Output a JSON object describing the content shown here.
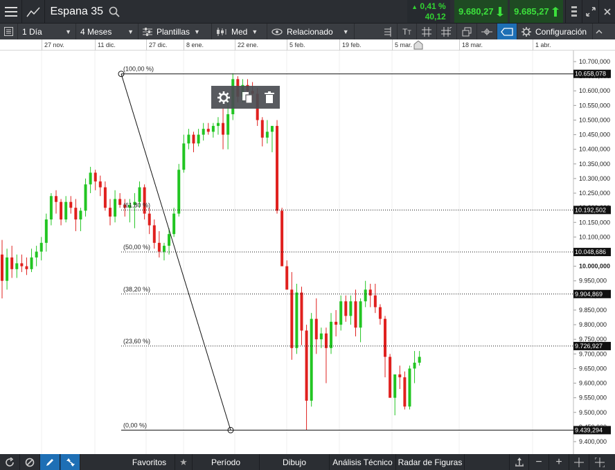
{
  "topbar": {
    "instrument": "Espana 35",
    "change_pct": "0,41 %",
    "change_abs": "40,12",
    "sell_price": "9.680,27",
    "buy_price": "9.685,27"
  },
  "toolbar": {
    "interval": "1 Día",
    "range": "4 Meses",
    "templates": "Plantillas",
    "price_type": "Med",
    "related": "Relacionado",
    "settings": "Configuración"
  },
  "date_axis": [
    "27 nov.",
    "11 dic.",
    "27 dic.",
    "8 ene.",
    "22 ene.",
    "5 feb.",
    "19 feb.",
    "5 mar.",
    "18 mar.",
    "1 abr."
  ],
  "bottombar": {
    "favorites": "Favoritos",
    "period": "Período",
    "drawing": "Dibujo",
    "technical": "Análisis Técnico",
    "patterns": "Radar de Figuras"
  },
  "colors": {
    "up": "#22c522",
    "down": "#e0201e",
    "accent": "#1e6fb5",
    "topbar": "#2b2e33",
    "toolbar": "#3a3d42"
  },
  "chart_data": {
    "type": "candlestick",
    "ylim": [
      9400,
      10700
    ],
    "y_ticks": [
      "10.700,000",
      "10.650,000",
      "10.600,000",
      "10.550,000",
      "10.500,000",
      "10.450,000",
      "10.400,000",
      "10.350,000",
      "10.300,000",
      "10.250,000",
      "10.200,000",
      "10.150,000",
      "10.100,000",
      "10.050,000",
      "10.000,000",
      "9.950,000",
      "9.900,000",
      "9.850,000",
      "9.800,000",
      "9.750,000",
      "9.700,000",
      "9.650,000",
      "9.600,000",
      "9.550,000",
      "9.500,000",
      "9.450,000",
      "9.400,000"
    ],
    "fibonacci": [
      {
        "label": "(100,00 %)",
        "value": 10658.078,
        "price_label": "10.658,078"
      },
      {
        "label": "(61,80 %)",
        "value": 10192.502,
        "price_label": "10.192,502"
      },
      {
        "label": "(50,00 %)",
        "value": 10048.686,
        "price_label": "10.048,686"
      },
      {
        "label": "(38,20 %)",
        "value": 9904.869,
        "price_label": "9.904,869"
      },
      {
        "label": "(23,60 %)",
        "value": 9726.927,
        "price_label": "9.726,927"
      },
      {
        "label": "(0,00 %)",
        "value": 9439.294,
        "price_label": "9.439,294"
      }
    ],
    "candles": [
      [
        10040,
        10090,
        9890,
        9950
      ],
      [
        9950,
        10060,
        9920,
        10030
      ],
      [
        10030,
        10070,
        9960,
        9990
      ],
      [
        9990,
        10040,
        9960,
        10010
      ],
      [
        10010,
        10040,
        9980,
        10000
      ],
      [
        10000,
        10030,
        9970,
        9990
      ],
      [
        9990,
        10060,
        9980,
        10030
      ],
      [
        10030,
        10070,
        10000,
        10050
      ],
      [
        10050,
        10100,
        10020,
        10080
      ],
      [
        10080,
        10180,
        10050,
        10160
      ],
      [
        10160,
        10250,
        10140,
        10240
      ],
      [
        10240,
        10260,
        10180,
        10220
      ],
      [
        10220,
        10230,
        10140,
        10160
      ],
      [
        10160,
        10240,
        10150,
        10220
      ],
      [
        10220,
        10240,
        10180,
        10200
      ],
      [
        10200,
        10230,
        10120,
        10160
      ],
      [
        10160,
        10200,
        10120,
        10190
      ],
      [
        10190,
        10300,
        10170,
        10280
      ],
      [
        10280,
        10340,
        10250,
        10320
      ],
      [
        10320,
        10330,
        10260,
        10290
      ],
      [
        10290,
        10310,
        10240,
        10270
      ],
      [
        10270,
        10290,
        10190,
        10200
      ],
      [
        10200,
        10230,
        10140,
        10170
      ],
      [
        10170,
        10260,
        10150,
        10230
      ],
      [
        10230,
        10250,
        10200,
        10210
      ],
      [
        10210,
        10230,
        10170,
        10200
      ],
      [
        10200,
        10230,
        10150,
        10210
      ],
      [
        10210,
        10250,
        10130,
        10220
      ],
      [
        10220,
        10290,
        10200,
        10270
      ],
      [
        10270,
        10280,
        10160,
        10180
      ],
      [
        10180,
        10200,
        10110,
        10140
      ],
      [
        10140,
        10160,
        10060,
        10080
      ],
      [
        10080,
        10120,
        10030,
        10050
      ],
      [
        10050,
        10080,
        10020,
        10070
      ],
      [
        10070,
        10130,
        10040,
        10110
      ],
      [
        10110,
        10200,
        10100,
        10180
      ],
      [
        10180,
        10350,
        10170,
        10330
      ],
      [
        10330,
        10450,
        10320,
        10420
      ],
      [
        10420,
        10470,
        10400,
        10450
      ],
      [
        10450,
        10460,
        10390,
        10420
      ],
      [
        10420,
        10470,
        10410,
        10450
      ],
      [
        10450,
        10490,
        10430,
        10470
      ],
      [
        10470,
        10490,
        10450,
        10460
      ],
      [
        10460,
        10490,
        10440,
        10480
      ],
      [
        10480,
        10510,
        10450,
        10490
      ],
      [
        10490,
        10540,
        10400,
        10450
      ],
      [
        10450,
        10580,
        10400,
        10520
      ],
      [
        10520,
        10660,
        10500,
        10640
      ],
      [
        10640,
        10650,
        10560,
        10580
      ],
      [
        10580,
        10640,
        10560,
        10620
      ],
      [
        10620,
        10640,
        10560,
        10600
      ],
      [
        10600,
        10630,
        10560,
        10590
      ],
      [
        10590,
        10610,
        10480,
        10500
      ],
      [
        10500,
        10510,
        10410,
        10440
      ],
      [
        10440,
        10500,
        10420,
        10460
      ],
      [
        10460,
        10480,
        10390,
        10480
      ],
      [
        10480,
        10500,
        10180,
        10190
      ],
      [
        10190,
        10200,
        10020,
        10000
      ],
      [
        10000,
        10020,
        9920,
        9920
      ],
      [
        9920,
        9980,
        9680,
        9720
      ],
      [
        9720,
        9940,
        9700,
        9910
      ],
      [
        9910,
        9930,
        9730,
        9780
      ],
      [
        9780,
        9800,
        9440,
        9540
      ],
      [
        9540,
        9840,
        9520,
        9820
      ],
      [
        9820,
        9890,
        9700,
        9750
      ],
      [
        9750,
        9790,
        9720,
        9770
      ],
      [
        9770,
        9790,
        9600,
        9720
      ],
      [
        9720,
        9840,
        9700,
        9810
      ],
      [
        9810,
        9850,
        9760,
        9800
      ],
      [
        9800,
        9900,
        9780,
        9880
      ],
      [
        9880,
        9900,
        9810,
        9830
      ],
      [
        9830,
        9900,
        9800,
        9880
      ],
      [
        9880,
        9920,
        9760,
        9790
      ],
      [
        9790,
        9890,
        9740,
        9880
      ],
      [
        9880,
        9950,
        9860,
        9920
      ],
      [
        9920,
        9940,
        9860,
        9900
      ],
      [
        9900,
        9940,
        9840,
        9860
      ],
      [
        9860,
        9870,
        9800,
        9820
      ],
      [
        9820,
        9830,
        9620,
        9690
      ],
      [
        9690,
        9700,
        9550,
        9550
      ],
      [
        9550,
        9560,
        9490,
        9630
      ],
      [
        9630,
        9660,
        9580,
        9620
      ],
      [
        9620,
        9640,
        9510,
        9520
      ],
      [
        9520,
        9660,
        9510,
        9650
      ],
      [
        9650,
        9710,
        9600,
        9670
      ],
      [
        9670,
        9710,
        9660,
        9690
      ]
    ]
  }
}
